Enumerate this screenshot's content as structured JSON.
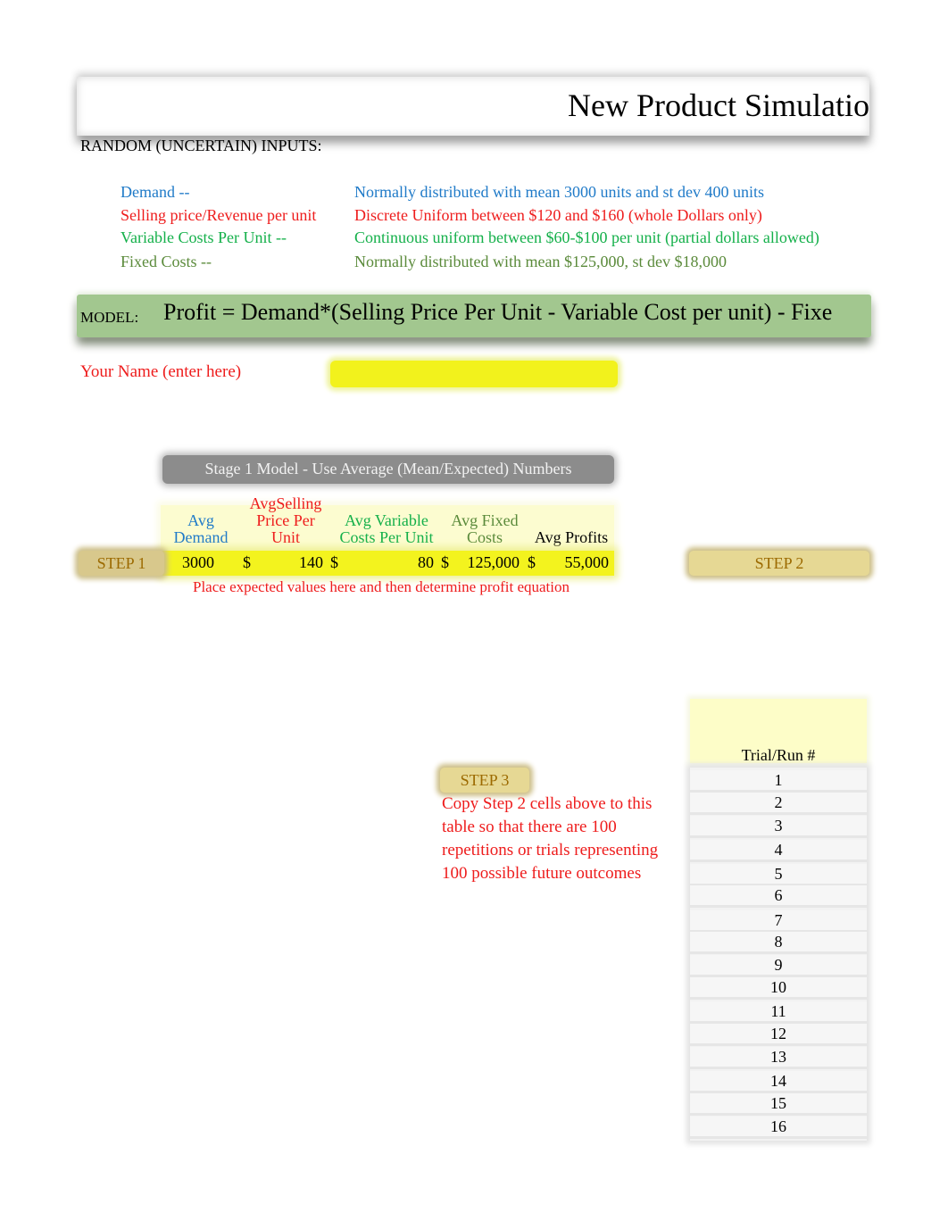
{
  "title": "New Product Simulatio",
  "random_inputs_label": "RANDOM (UNCERTAIN) INPUTS:",
  "inputs": [
    {
      "label": "Demand --",
      "description": "Normally distributed with mean 3000 units and st dev 400 units",
      "color": "#1f7ac8"
    },
    {
      "label": "Selling price/Revenue per unit",
      "description": "Discrete Uniform between $120 and $160 (whole Dollars only)",
      "color": "#ee1c1c"
    },
    {
      "label": "Variable Costs Per Unit --",
      "description": "Continuous uniform between $60-$100 per unit (partial dollars allowed)",
      "color": "#14b04a"
    },
    {
      "label": "Fixed Costs --",
      "description": "Normally distributed with mean $125,000, st dev $18,000",
      "color": "#5a8a3a"
    }
  ],
  "model": {
    "label": "MODEL:",
    "formula": "Profit = Demand*(Selling Price Per Unit - Variable Cost per unit) - Fixe"
  },
  "name_field": {
    "label": "Your Name (enter here)",
    "value": "",
    "highlight_color": "#f2f21c"
  },
  "stage1": {
    "title": "Stage 1 Model - Use Average (Mean/Expected) Numbers",
    "headers": [
      {
        "line1": "",
        "line2": "Avg",
        "line3": "Demand",
        "color": "#1f7ac8"
      },
      {
        "line1": "AvgSelling",
        "line2": "Price Per",
        "line3": "Unit",
        "color": "#ee1c1c"
      },
      {
        "line1": "",
        "line2": "Avg Variable",
        "line3": "Costs Per Unit",
        "color": "#14b04a"
      },
      {
        "line1": "",
        "line2": "Avg Fixed",
        "line3": "Costs",
        "color": "#5a8a3a"
      },
      {
        "line1": "",
        "line2": "",
        "line3": "Avg Profits",
        "color": "#000000"
      }
    ],
    "values": {
      "avg_demand": "3000",
      "currency": "$",
      "avg_selling_price": "140",
      "avg_variable_cost": "80",
      "avg_fixed_costs": "125,000",
      "avg_profits": "55,000"
    },
    "note": "Place expected values here and then determine profit equation"
  },
  "steps": {
    "step1": "STEP 1",
    "step2": "STEP 2",
    "step3": "STEP 3",
    "step3_text": "Copy Step 2 cells above to this table so that there are 100 repetitions or trials representing 100 possible future outcomes"
  },
  "trial_table": {
    "header": "Trial/Run #",
    "rows": [
      "1",
      "2",
      "3",
      "4",
      "5",
      "6",
      "7",
      "8",
      "9",
      "10",
      "11",
      "12",
      "13",
      "14",
      "15",
      "16"
    ]
  }
}
